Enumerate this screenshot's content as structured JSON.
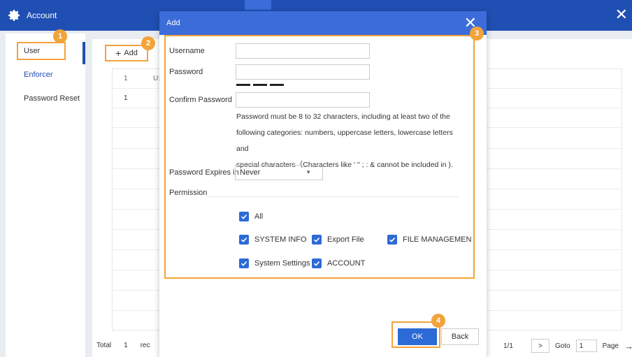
{
  "app": {
    "title": "Account"
  },
  "sidebar": {
    "items": [
      {
        "label": "User"
      },
      {
        "label": "Enforcer"
      },
      {
        "label": "Password Reset"
      }
    ]
  },
  "toolbar": {
    "add_label": "Add"
  },
  "table": {
    "header_no": "1",
    "header_user": "U:",
    "row_no": "1"
  },
  "footer": {
    "total_label": "Total",
    "total_count": "1",
    "records_label": "rec"
  },
  "pager": {
    "page_info": "1/1",
    "next": ">",
    "goto_label": "Goto",
    "goto_value": "1",
    "page_label": "Page",
    "go_arrow": "→"
  },
  "modal": {
    "title": "Add",
    "username_label": "Username",
    "password_label": "Password",
    "confirm_label": "Confirm Password",
    "hint_line1": "Password must be 8 to 32 characters, including at least two of the",
    "hint_line2": "following categories: numbers, uppercase letters, lowercase letters and",
    "hint_line3": "special characters（Characters like ' \" ; : & cannot be included in ).",
    "expires_label": "Password Expires in",
    "expires_value": "Never",
    "permission_label": "Permission",
    "perm_all": "All",
    "perm_system_info": "SYSTEM INFO",
    "perm_export_file": "Export File",
    "perm_file_mgmt": "FILE MANAGEMEN",
    "perm_system_settings": "System Settings",
    "perm_account": "ACCOUNT",
    "ok_label": "OK",
    "back_label": "Back"
  },
  "badges": [
    "1",
    "2",
    "3",
    "4"
  ],
  "colors": {
    "accent": "#2c6ad6",
    "header": "#1f4fb3",
    "highlight": "#f2a33a"
  }
}
